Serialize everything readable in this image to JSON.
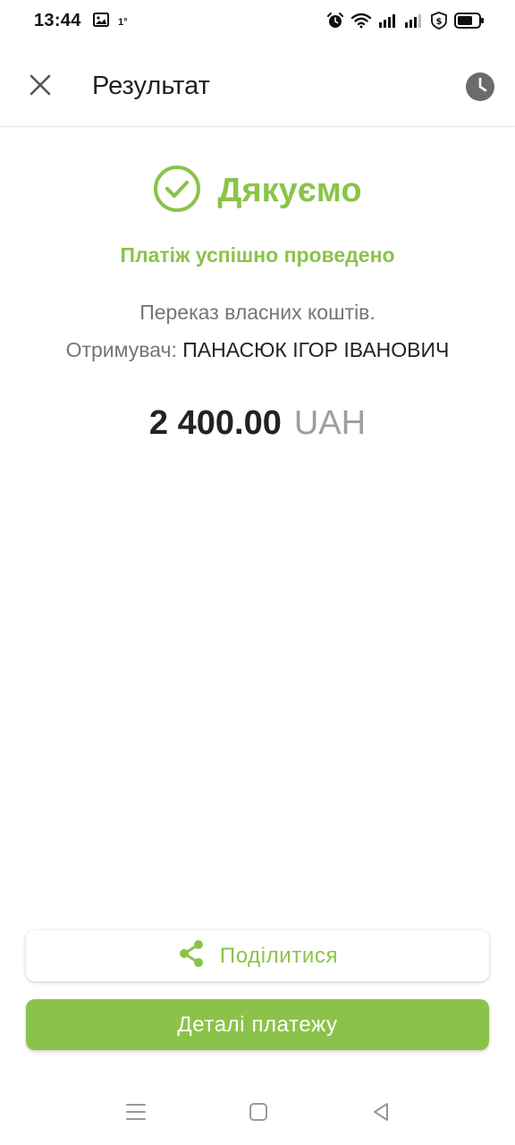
{
  "status_bar": {
    "time": "13:44",
    "temperature": "1°",
    "icons": [
      "gallery-icon",
      "alarm-icon",
      "wifi-icon",
      "signal-icon",
      "signal-2-icon",
      "shield-dollar-icon",
      "battery-icon"
    ]
  },
  "app_bar": {
    "title": "Результат",
    "close_icon": "close-icon",
    "history_icon": "clock-icon"
  },
  "result": {
    "thanks": "Дякуємо",
    "success": "Платіж успішно проведено",
    "description": "Переказ власних коштів.",
    "recipient_label": "Отримувач:",
    "recipient_name": "ПАНАСЮК ІГОР ІВАНОВИЧ",
    "amount": "2 400.00",
    "currency": "UAH"
  },
  "actions": {
    "share_label": "Поділитися",
    "details_label": "Деталі платежу"
  },
  "colors": {
    "accent": "#8bc34a",
    "secondary_text": "#757575",
    "primary_text": "#222222"
  },
  "nav_bar": {
    "icons": [
      "menu-icon",
      "home-icon",
      "back-icon"
    ]
  }
}
